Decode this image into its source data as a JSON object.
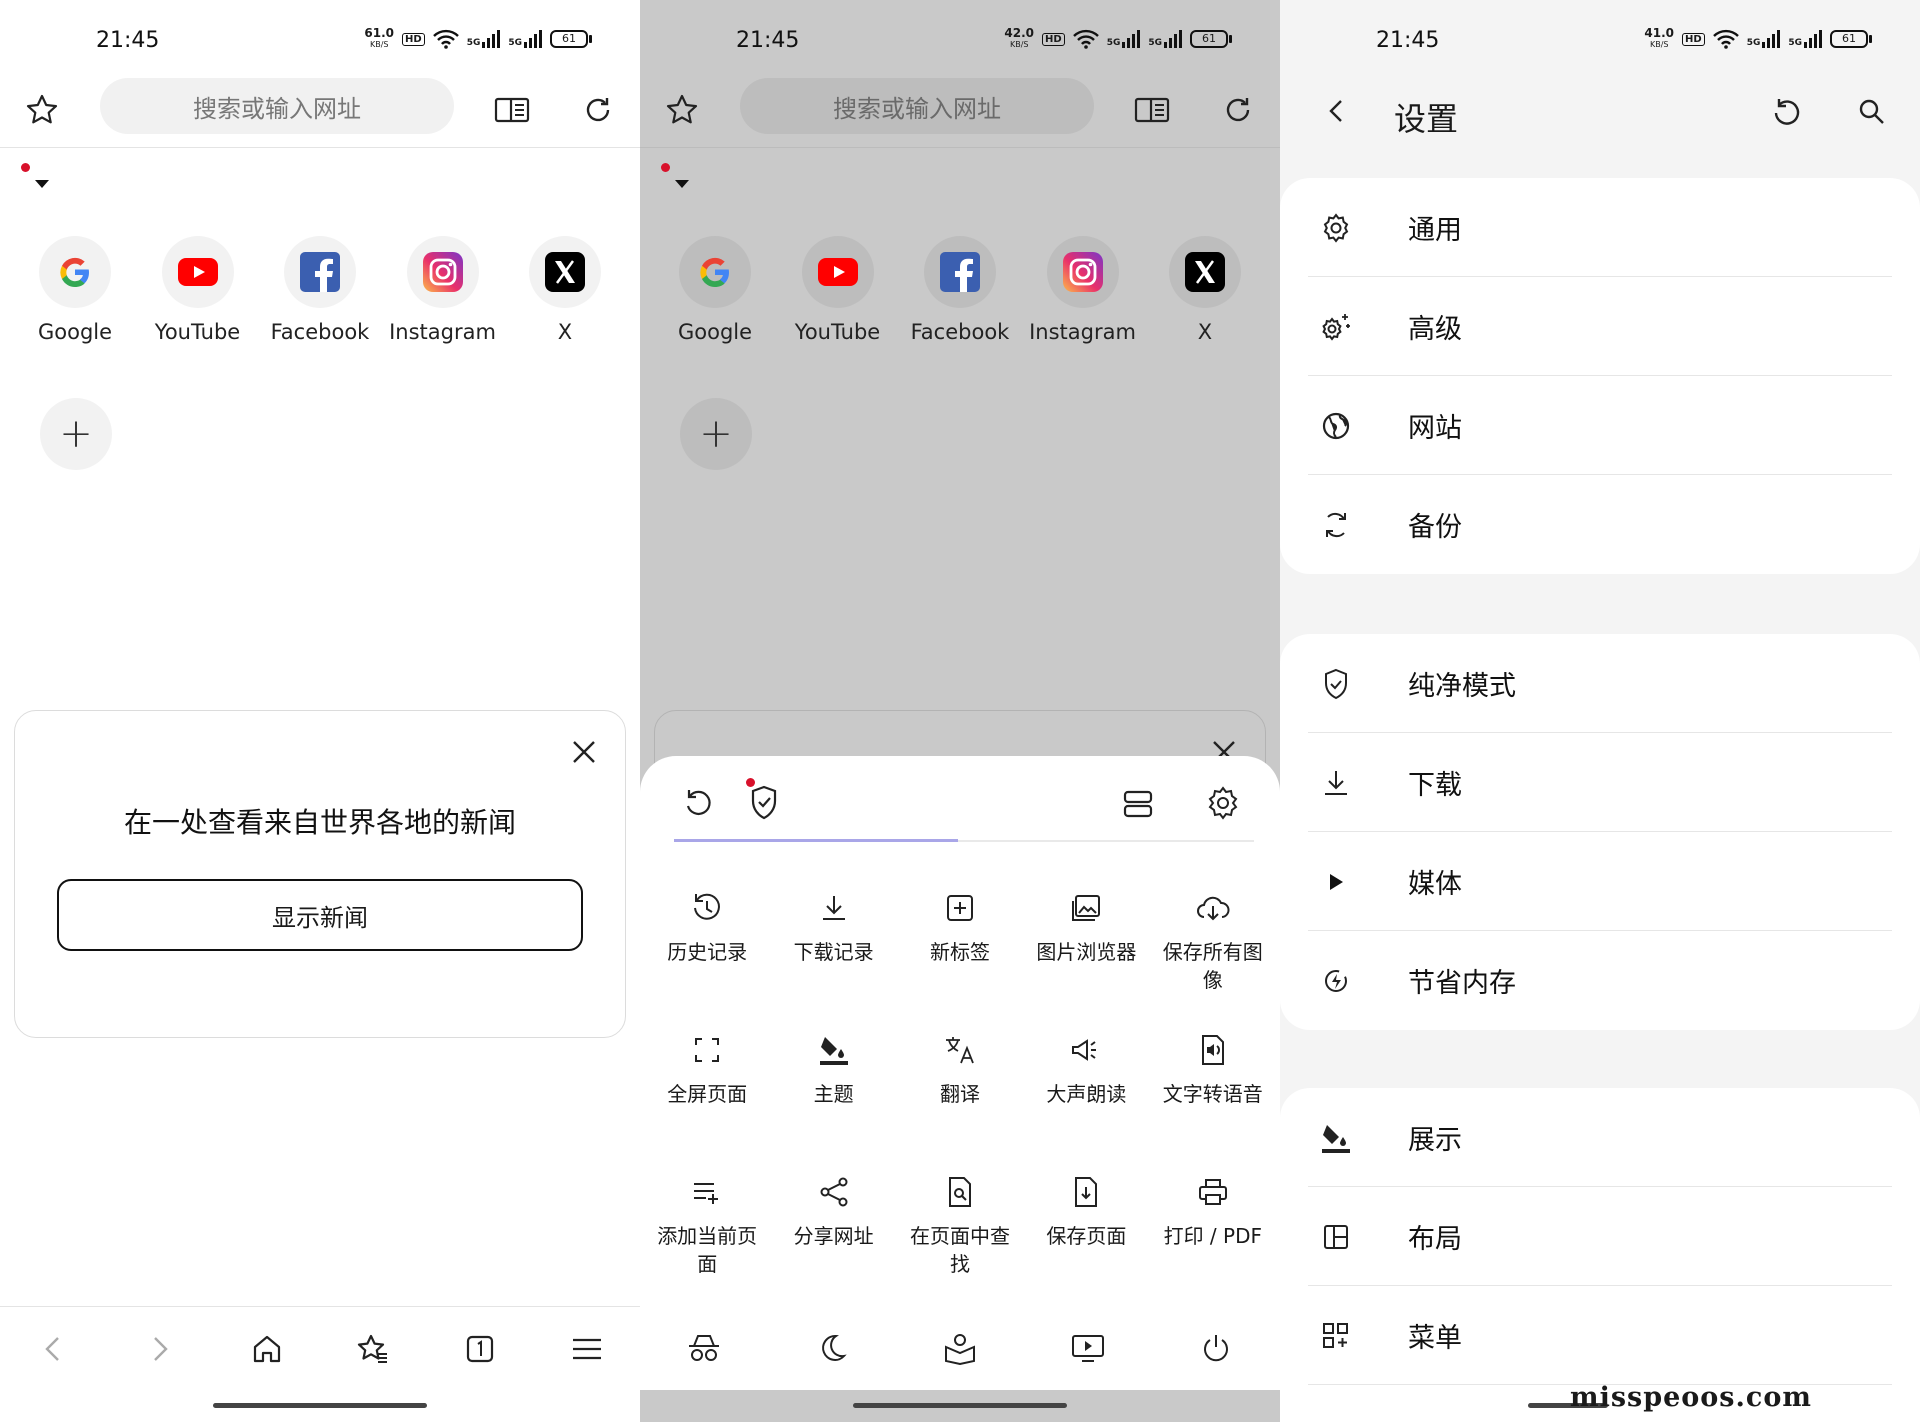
{
  "screens": {
    "left": {
      "status": {
        "time": "21:45",
        "speed": "61.0",
        "speed_unit": "KB/S",
        "hd": "HD",
        "net1": "5G",
        "net2": "5G",
        "battery": "61"
      },
      "search_placeholder": "搜索或输入网址",
      "shortcuts": [
        {
          "label": "Google",
          "icon": "google-icon"
        },
        {
          "label": "YouTube",
          "icon": "youtube-icon"
        },
        {
          "label": "Facebook",
          "icon": "facebook-icon"
        },
        {
          "label": "Instagram",
          "icon": "instagram-icon"
        },
        {
          "label": "X",
          "icon": "x-icon"
        }
      ],
      "add_label": "+",
      "news": {
        "title": "在一处查看来自世界各地的新闻",
        "button": "显示新闻"
      }
    },
    "middle": {
      "status": {
        "time": "21:45",
        "speed": "42.0",
        "speed_unit": "KB/S",
        "hd": "HD",
        "net1": "5G",
        "net2": "5G",
        "battery": "61"
      },
      "search_placeholder": "搜索或输入网址",
      "shortcuts": [
        {
          "label": "Google",
          "icon": "google-icon"
        },
        {
          "label": "YouTube",
          "icon": "youtube-icon"
        },
        {
          "label": "Facebook",
          "icon": "facebook-icon"
        },
        {
          "label": "Instagram",
          "icon": "instagram-icon"
        },
        {
          "label": "X",
          "icon": "x-icon"
        }
      ],
      "add_label": "+",
      "menu_items": [
        {
          "label": "历史记录",
          "icon": "history-icon"
        },
        {
          "label": "下载记录",
          "icon": "download-icon"
        },
        {
          "label": "新标签",
          "icon": "new-tab-icon"
        },
        {
          "label": "图片浏览器",
          "icon": "image-browser-icon"
        },
        {
          "label": "保存所有图像",
          "icon": "cloud-save-icon"
        },
        {
          "label": "全屏页面",
          "icon": "fullscreen-icon"
        },
        {
          "label": "主题",
          "icon": "theme-icon"
        },
        {
          "label": "翻译",
          "icon": "translate-icon"
        },
        {
          "label": "大声朗读",
          "icon": "megaphone-icon"
        },
        {
          "label": "文字转语音",
          "icon": "text-to-speech-icon"
        },
        {
          "label": "添加当前页面",
          "icon": "add-to-list-icon"
        },
        {
          "label": "分享网址",
          "icon": "share-icon"
        },
        {
          "label": "在页面中查找",
          "icon": "find-in-page-icon"
        },
        {
          "label": "保存页面",
          "icon": "save-page-icon"
        },
        {
          "label": "打印 / PDF",
          "icon": "print-icon"
        }
      ]
    },
    "right": {
      "status": {
        "time": "21:45",
        "speed": "41.0",
        "speed_unit": "KB/S",
        "hd": "HD",
        "net1": "5G",
        "net2": "5G",
        "battery": "61"
      },
      "title": "设置",
      "groups": [
        [
          {
            "label": "通用",
            "icon": "gear-icon"
          },
          {
            "label": "高级",
            "icon": "advanced-gear-icon"
          },
          {
            "label": "网站",
            "icon": "globe-icon"
          },
          {
            "label": "备份",
            "icon": "sync-icon"
          }
        ],
        [
          {
            "label": "纯净模式",
            "icon": "shield-icon"
          },
          {
            "label": "下载",
            "icon": "download-icon"
          },
          {
            "label": "媒体",
            "icon": "play-icon"
          },
          {
            "label": "节省内存",
            "icon": "memory-saver-icon"
          }
        ],
        [
          {
            "label": "展示",
            "icon": "paint-bucket-icon"
          },
          {
            "label": "布局",
            "icon": "layout-icon"
          },
          {
            "label": "菜单",
            "icon": "menu-grid-icon"
          }
        ]
      ],
      "watermark": "misspeoos.com"
    }
  }
}
